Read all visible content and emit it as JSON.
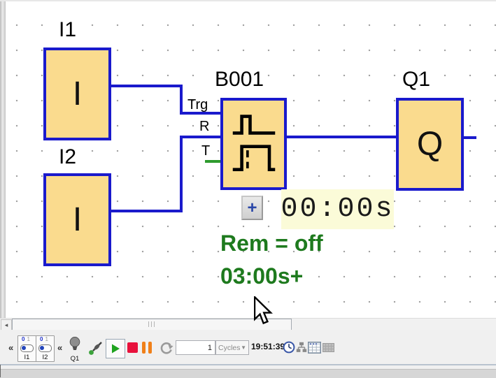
{
  "diagram": {
    "blocks": {
      "i1": {
        "label": "I1",
        "letter": "I"
      },
      "i2": {
        "label": "I2",
        "letter": "I"
      },
      "b001": {
        "label": "B001",
        "pins": {
          "trg": "Trg",
          "r": "R",
          "t": "T"
        }
      },
      "q1": {
        "label": "Q1",
        "letter": "Q"
      }
    },
    "timer_display": "00:00s",
    "annotations": {
      "rem": "Rem = off",
      "delay": "03:00s+"
    },
    "expand_button_label": "+"
  },
  "sim_toolbar": {
    "collapse_left": "«",
    "collapse_right": "«",
    "switches": [
      {
        "label": "I1",
        "state_off": "0",
        "state_on": "1"
      },
      {
        "label": "I2",
        "state_off": "0",
        "state_on": "1"
      }
    ],
    "lamp_label": "Q1",
    "cycles_value": "1",
    "cycles_unit": "Cycles",
    "clock_time": "19:51:39"
  },
  "scrollbar": {
    "left_arrow": "◂"
  },
  "icons": {
    "probe": "logic-probe-with-green-dot",
    "play": "green-triangle",
    "stop": "red-square",
    "pause": "orange-double-bars",
    "step": "circular-arrow",
    "clock": "analog-clock",
    "tree": "network-tree",
    "table": "data-table",
    "keypad": "grid-disabled",
    "lamp": "lightbulb-off",
    "expand": "plus",
    "timer_block": "pulse-waveforms"
  },
  "colors": {
    "block_fill": "#FADB8E",
    "block_border": "#1A1ACC",
    "wire": "#1A1ACC",
    "t_stub_green": "#2E9B2E",
    "annotation_green": "#1E7A1E",
    "timer_bg": "#FBFBD8",
    "play_green": "#1FA31F",
    "stop_red": "#E8113C",
    "pause_orange": "#F08019"
  }
}
